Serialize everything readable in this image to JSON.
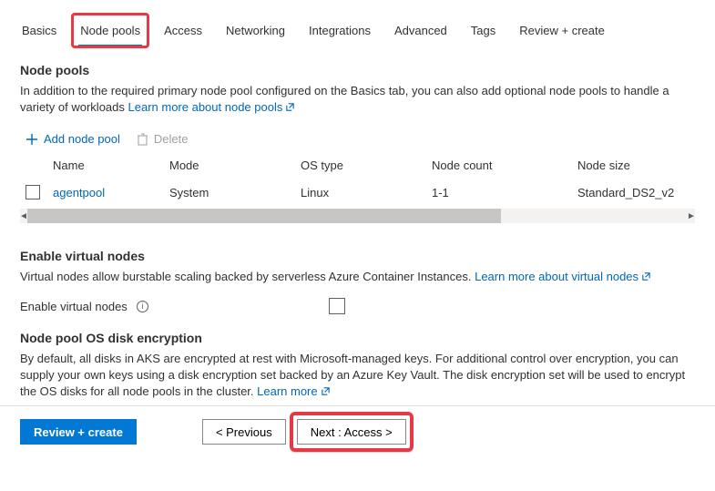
{
  "tabs": {
    "basics": "Basics",
    "nodepools": "Node pools",
    "access": "Access",
    "networking": "Networking",
    "integrations": "Integrations",
    "advanced": "Advanced",
    "tags": "Tags",
    "review": "Review + create"
  },
  "section1": {
    "heading": "Node pools",
    "desc_prefix": "In addition to the required primary node pool configured on the Basics tab, you can also add optional node pools to handle a variety of workloads ",
    "learn_more": "Learn more about node pools"
  },
  "toolbar": {
    "add": "Add node pool",
    "delete": "Delete"
  },
  "table": {
    "headers": {
      "name": "Name",
      "mode": "Mode",
      "ostype": "OS type",
      "nodecount": "Node count",
      "nodesize": "Node size"
    },
    "rows": [
      {
        "name": "agentpool",
        "mode": "System",
        "ostype": "Linux",
        "nodecount": "1-1",
        "nodesize": "Standard_DS2_v2"
      }
    ]
  },
  "section2": {
    "heading": "Enable virtual nodes",
    "desc_prefix": "Virtual nodes allow burstable scaling backed by serverless Azure Container Instances. ",
    "learn_more": "Learn more about virtual nodes",
    "field_label": "Enable virtual nodes"
  },
  "section3": {
    "heading": "Node pool OS disk encryption",
    "desc_prefix": "By default, all disks in AKS are encrypted at rest with Microsoft-managed keys. For additional control over encryption, you can supply your own keys using a disk encryption set backed by an Azure Key Vault. The disk encryption set will be used to encrypt the OS disks for all node pools in the cluster. ",
    "learn_more": "Learn more"
  },
  "footer": {
    "review": "Review + create",
    "previous": "< Previous",
    "next": "Next : Access >"
  }
}
